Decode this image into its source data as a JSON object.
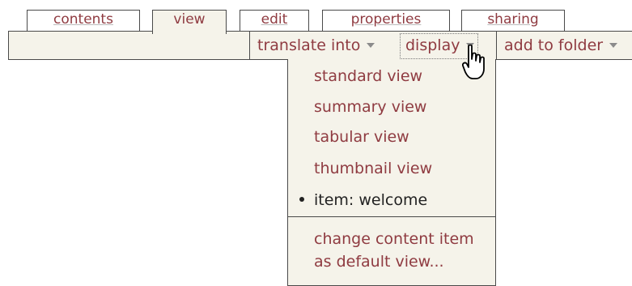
{
  "tabs": [
    {
      "label": "contents"
    },
    {
      "label": "view",
      "active": true
    },
    {
      "label": "edit"
    },
    {
      "label": "properties"
    },
    {
      "label": "sharing"
    }
  ],
  "actions": {
    "translate": "translate into",
    "display": "display",
    "add_to_folder": "add to folder"
  },
  "display_menu": {
    "items": [
      "standard view",
      "summary view",
      "tabular view",
      "thumbnail view"
    ],
    "current": "item: welcome",
    "extra_line1": "change content item",
    "extra_line2": "as default view..."
  },
  "colors": {
    "link": "#8f3b41",
    "bar_background": "#f5f3ea",
    "border": "#4a4a4a"
  }
}
